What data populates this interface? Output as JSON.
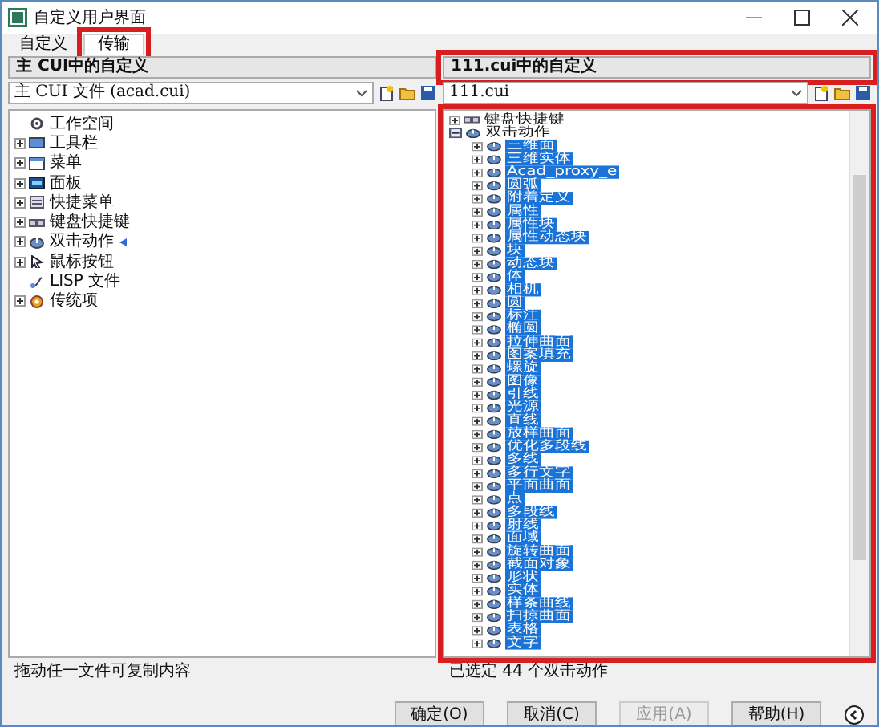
{
  "window": {
    "title": "自定义用户界面"
  },
  "tabs": [
    {
      "label": "自定义",
      "selected": false,
      "highlighted": false
    },
    {
      "label": "传输",
      "selected": true,
      "highlighted": true
    }
  ],
  "left_panel": {
    "header": "主 CUI中的自定义",
    "header_highlighted": false,
    "file": "主 CUI 文件 (acad.cui)",
    "tree": [
      {
        "label": "工作空间",
        "kind": "workspaces"
      },
      {
        "label": "工具栏",
        "kind": "toolbars",
        "expanded": false
      },
      {
        "label": "菜单",
        "kind": "menus",
        "expanded": false
      },
      {
        "label": "面板",
        "kind": "panels",
        "expanded": false
      },
      {
        "label": "快捷菜单",
        "kind": "shortcut_menus",
        "expanded": false
      },
      {
        "label": "键盘快捷键",
        "kind": "keyboard_shortcuts",
        "expanded": false
      },
      {
        "label": "双击动作",
        "kind": "double_click_actions",
        "expanded": false,
        "drop_marker": true
      },
      {
        "label": "鼠标按钮",
        "kind": "mouse_buttons",
        "expanded": false
      },
      {
        "label": "LISP 文件",
        "kind": "lisp_files"
      },
      {
        "label": "传统项",
        "kind": "legacy",
        "expanded": false
      }
    ],
    "status": "拖动任一文件可复制内容"
  },
  "right_panel": {
    "header": "111.cui中的自定义",
    "header_highlighted": true,
    "file": "111.cui",
    "tree_highlighted": true,
    "tree": [
      {
        "label": "键盘快捷键",
        "kind": "keyboard_shortcuts",
        "expanded": false,
        "selected": false
      },
      {
        "label": "双击动作",
        "kind": "double_click_actions",
        "expanded": true,
        "selected": false,
        "children": [
          {
            "label": "三维面",
            "selected": true
          },
          {
            "label": "三维实体",
            "selected": true
          },
          {
            "label": "Acad_proxy_e",
            "selected": true
          },
          {
            "label": "圆弧",
            "selected": true
          },
          {
            "label": "附着定义",
            "selected": true
          },
          {
            "label": "属性",
            "selected": true
          },
          {
            "label": "属性块",
            "selected": true
          },
          {
            "label": "属性动态块",
            "selected": true
          },
          {
            "label": "块",
            "selected": true
          },
          {
            "label": "动态块",
            "selected": true
          },
          {
            "label": "体",
            "selected": true
          },
          {
            "label": "相机",
            "selected": true
          },
          {
            "label": "圆",
            "selected": true
          },
          {
            "label": "标注",
            "selected": true
          },
          {
            "label": "椭圆",
            "selected": true
          },
          {
            "label": "拉伸曲面",
            "selected": true
          },
          {
            "label": "图案填充",
            "selected": true
          },
          {
            "label": "螺旋",
            "selected": true
          },
          {
            "label": "图像",
            "selected": true
          },
          {
            "label": "引线",
            "selected": true
          },
          {
            "label": "光源",
            "selected": true
          },
          {
            "label": "直线",
            "selected": true
          },
          {
            "label": "放样曲面",
            "selected": true
          },
          {
            "label": "优化多段线",
            "selected": true
          },
          {
            "label": "多线",
            "selected": true
          },
          {
            "label": "多行文字",
            "selected": true
          },
          {
            "label": "平面曲面",
            "selected": true
          },
          {
            "label": "点",
            "selected": true
          },
          {
            "label": "多段线",
            "selected": true
          },
          {
            "label": "射线",
            "selected": true
          },
          {
            "label": "面域",
            "selected": true
          },
          {
            "label": "旋转曲面",
            "selected": true
          },
          {
            "label": "截面对象",
            "selected": true
          },
          {
            "label": "形状",
            "selected": true
          },
          {
            "label": "实体",
            "selected": true
          },
          {
            "label": "样条曲线",
            "selected": true
          },
          {
            "label": "扫掠曲面",
            "selected": true
          },
          {
            "label": "表格",
            "selected": true
          },
          {
            "label": "文字",
            "selected": true
          }
        ]
      }
    ],
    "status": "已选定 44 个双击动作"
  },
  "buttons": [
    {
      "label": "确定(O)",
      "disabled": false
    },
    {
      "label": "取消(C)",
      "disabled": false
    },
    {
      "label": "应用(A)",
      "disabled": true
    },
    {
      "label": "帮助(H)",
      "disabled": false
    }
  ]
}
